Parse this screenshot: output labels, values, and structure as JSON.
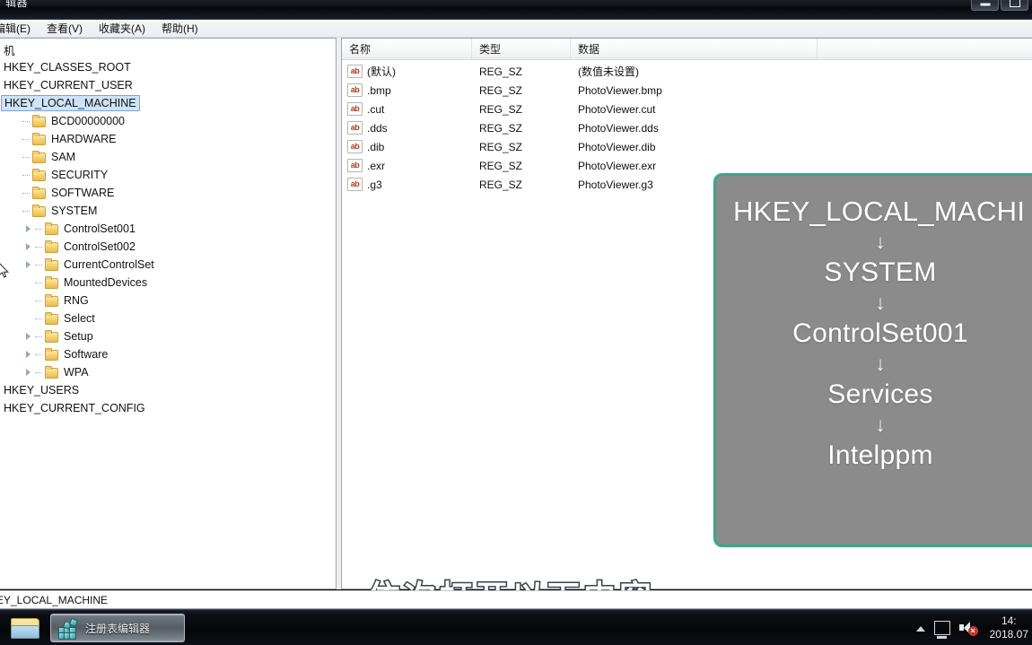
{
  "window": {
    "title": "辑器",
    "minimize_label": "",
    "maximize_label": ""
  },
  "menubar": {
    "items": [
      {
        "label": "编辑(E)"
      },
      {
        "label": "查看(V)"
      },
      {
        "label": "收藏夹(A)"
      },
      {
        "label": "帮助(H)"
      }
    ]
  },
  "tree": {
    "items": [
      {
        "label": "机",
        "level": 0,
        "twisty": false,
        "folder": false,
        "selected": false
      },
      {
        "label": "HKEY_CLASSES_ROOT",
        "level": 0,
        "twisty": false,
        "folder": false,
        "selected": false
      },
      {
        "label": "HKEY_CURRENT_USER",
        "level": 0,
        "twisty": false,
        "folder": false,
        "selected": false
      },
      {
        "label": "HKEY_LOCAL_MACHINE",
        "level": 0,
        "twisty": false,
        "folder": false,
        "selected": true
      },
      {
        "label": "BCD00000000",
        "level": 1,
        "twisty": false,
        "folder": true,
        "selected": false
      },
      {
        "label": "HARDWARE",
        "level": 1,
        "twisty": false,
        "folder": true,
        "selected": false
      },
      {
        "label": "SAM",
        "level": 1,
        "twisty": false,
        "folder": true,
        "selected": false
      },
      {
        "label": "SECURITY",
        "level": 1,
        "twisty": false,
        "folder": true,
        "selected": false
      },
      {
        "label": "SOFTWARE",
        "level": 1,
        "twisty": false,
        "folder": true,
        "selected": false
      },
      {
        "label": "SYSTEM",
        "level": 1,
        "twisty": false,
        "folder": true,
        "selected": false
      },
      {
        "label": "ControlSet001",
        "level": 2,
        "twisty": true,
        "folder": true,
        "selected": false
      },
      {
        "label": "ControlSet002",
        "level": 2,
        "twisty": true,
        "folder": true,
        "selected": false
      },
      {
        "label": "CurrentControlSet",
        "level": 2,
        "twisty": true,
        "folder": true,
        "selected": false
      },
      {
        "label": "MountedDevices",
        "level": 2,
        "twisty": false,
        "folder": true,
        "selected": false
      },
      {
        "label": "RNG",
        "level": 2,
        "twisty": false,
        "folder": true,
        "selected": false
      },
      {
        "label": "Select",
        "level": 2,
        "twisty": false,
        "folder": true,
        "selected": false
      },
      {
        "label": "Setup",
        "level": 2,
        "twisty": true,
        "folder": true,
        "selected": false
      },
      {
        "label": "Software",
        "level": 2,
        "twisty": true,
        "folder": true,
        "selected": false
      },
      {
        "label": "WPA",
        "level": 2,
        "twisty": true,
        "folder": true,
        "selected": false
      },
      {
        "label": "HKEY_USERS",
        "level": 0,
        "twisty": false,
        "folder": false,
        "selected": false
      },
      {
        "label": "HKEY_CURRENT_CONFIG",
        "level": 0,
        "twisty": false,
        "folder": false,
        "selected": false
      }
    ]
  },
  "list": {
    "columns": [
      {
        "label": "名称"
      },
      {
        "label": "类型"
      },
      {
        "label": "数据"
      }
    ],
    "icon_label": "ab",
    "rows": [
      {
        "name": "(默认)",
        "type": "REG_SZ",
        "data": "(数值未设置)"
      },
      {
        "name": ".bmp",
        "type": "REG_SZ",
        "data": "PhotoViewer.bmp"
      },
      {
        "name": ".cut",
        "type": "REG_SZ",
        "data": "PhotoViewer.cut"
      },
      {
        "name": ".dds",
        "type": "REG_SZ",
        "data": "PhotoViewer.dds"
      },
      {
        "name": ".dib",
        "type": "REG_SZ",
        "data": "PhotoViewer.dib"
      },
      {
        "name": ".exr",
        "type": "REG_SZ",
        "data": "PhotoViewer.exr"
      },
      {
        "name": ".g3",
        "type": "REG_SZ",
        "data": "PhotoViewer.g3"
      }
    ]
  },
  "callout": {
    "border_color": "#35a98b",
    "background_color": "#8b8b8b",
    "arrow": "↓",
    "steps": [
      {
        "label": "HKEY_LOCAL_MACHI"
      },
      {
        "label": "SYSTEM"
      },
      {
        "label": "ControlSet001"
      },
      {
        "label": "Services"
      },
      {
        "label": "Intelppm"
      }
    ]
  },
  "subtitle": {
    "text": "依次打开以下内容"
  },
  "statusbar": {
    "path": "EY_LOCAL_MACHINE"
  },
  "taskbar": {
    "quick_launch_label": "",
    "task_label": "注册表编辑器",
    "tray": {
      "show_hidden_label": "",
      "network_label": "",
      "volume_label": "",
      "mute_badge": "×",
      "time": "14:",
      "date": "2018.07"
    }
  }
}
